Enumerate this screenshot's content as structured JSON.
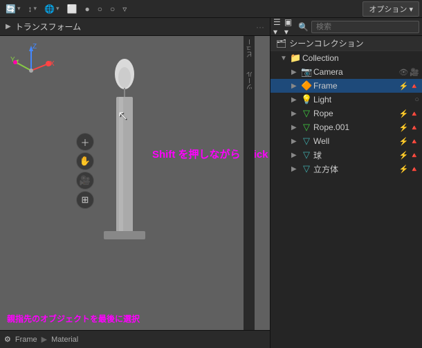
{
  "topbar": {
    "options_label": "オプション ▾"
  },
  "viewport": {
    "transform_title": "トランスフォーム",
    "shift_text": "Shift を押しながら Click",
    "bottom_status": "親指先のオブジェクトを最後に選択",
    "breadcrumb": [
      "Frame",
      "Material"
    ],
    "header_icons": [
      "🔄",
      "↕",
      "🌐",
      "⬜",
      "●",
      "○",
      "○",
      "▿"
    ]
  },
  "outliner": {
    "search_placeholder": "検索",
    "scene_label": "シーンコレクション",
    "collection_label": "Collection",
    "items": [
      {
        "id": "camera",
        "label": "Camera",
        "icon": "📷",
        "color": "icon-camera",
        "depth": 2
      },
      {
        "id": "frame",
        "label": "Frame",
        "icon": "🟠",
        "color": "icon-orange",
        "depth": 2,
        "selected": true
      },
      {
        "id": "light",
        "label": "Light",
        "icon": "💡",
        "color": "icon-yellow",
        "depth": 2
      },
      {
        "id": "rope",
        "label": "Rope",
        "icon": "▽",
        "color": "icon-green",
        "depth": 2
      },
      {
        "id": "rope001",
        "label": "Rope.001",
        "icon": "▽",
        "color": "icon-green",
        "depth": 2
      },
      {
        "id": "well",
        "label": "Well",
        "icon": "▽",
        "color": "icon-teal",
        "depth": 2
      },
      {
        "id": "ball",
        "label": "球",
        "icon": "▽",
        "color": "icon-teal",
        "depth": 2
      },
      {
        "id": "cube",
        "label": "立方体",
        "icon": "▽",
        "color": "icon-teal",
        "depth": 2
      }
    ]
  },
  "bottom_bar": {
    "frame_label": "Frame",
    "material_label": "Material"
  }
}
